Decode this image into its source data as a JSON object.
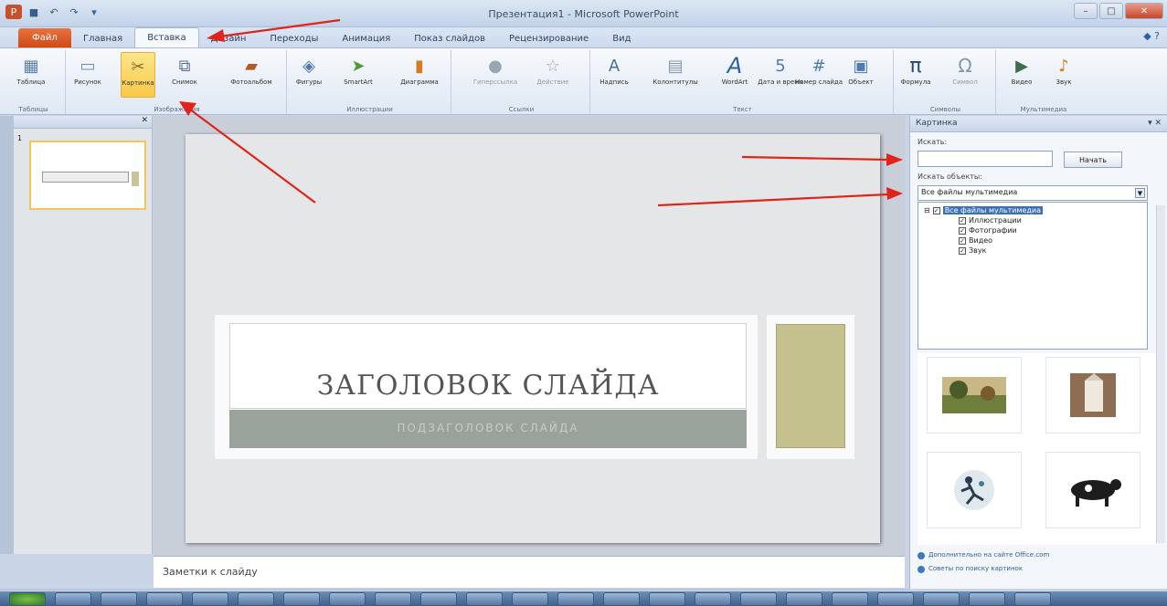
{
  "window": {
    "title": "Презентация1 - Microsoft PowerPoint"
  },
  "tabs": {
    "file": "Файл",
    "items": [
      {
        "label": "Главная",
        "active": false
      },
      {
        "label": "Вставка",
        "active": true
      },
      {
        "label": "Дизайн",
        "active": false
      },
      {
        "label": "Переходы",
        "active": false
      },
      {
        "label": "Анимация",
        "active": false
      },
      {
        "label": "Показ слайдов",
        "active": false
      },
      {
        "label": "Рецензирование",
        "active": false
      },
      {
        "label": "Вид",
        "active": false
      }
    ]
  },
  "ribbon": {
    "groups": {
      "tables": "Таблицы",
      "images": "Изображения",
      "illustrations": "Иллюстрации",
      "links": "Ссылки",
      "text": "Текст",
      "symbols": "Символы",
      "media": "Мультимедиа"
    },
    "buttons": {
      "table": "Таблица",
      "picture": "Рисунок",
      "clipart": "Картинка",
      "screenshot": "Снимок",
      "album": "Фотоальбом",
      "shapes": "Фигуры",
      "smartart": "SmartArt",
      "chart": "Диаграмма",
      "hyperlink": "Гиперссылка",
      "action": "Действие",
      "textbox": "Надпись",
      "header": "Колонтитулы",
      "wordart": "WordArt",
      "datetime": "Дата и время",
      "slidenum": "Номер слайда",
      "object": "Объект",
      "equation": "Формула",
      "symbol": "Символ",
      "video": "Видео",
      "audio": "Звук"
    }
  },
  "slides_pane": {
    "slide_number": "1"
  },
  "slide": {
    "title": "ЗАГОЛОВОК СЛАЙДА",
    "subtitle": "ПОДЗАГОЛОВОК СЛАЙДА"
  },
  "notes": {
    "placeholder": "Заметки к слайду"
  },
  "clipart_pane": {
    "title": "Картинка",
    "search_label": "Искать:",
    "search_value": "",
    "search_button": "Начать",
    "type_label": "Искать объекты:",
    "type_value": "Все файлы мультимедиа",
    "tree": [
      {
        "label": "Все файлы мультимедиа",
        "checked": true,
        "selected": true
      },
      {
        "label": "Иллюстрации",
        "checked": true,
        "selected": false
      },
      {
        "label": "Фотографии",
        "checked": true,
        "selected": false
      },
      {
        "label": "Видео",
        "checked": true,
        "selected": false
      },
      {
        "label": "Звук",
        "checked": true,
        "selected": false
      }
    ],
    "links": [
      "Дополнительно на сайте Office.com",
      "Советы по поиску картинок"
    ]
  },
  "colors": {
    "file_tab": "#cf4a17",
    "active_button": "#f7c948",
    "annotation_arrow": "#e0241b",
    "slide_accent": "#c4c18f",
    "subtitle_band": "#9aa39b"
  }
}
